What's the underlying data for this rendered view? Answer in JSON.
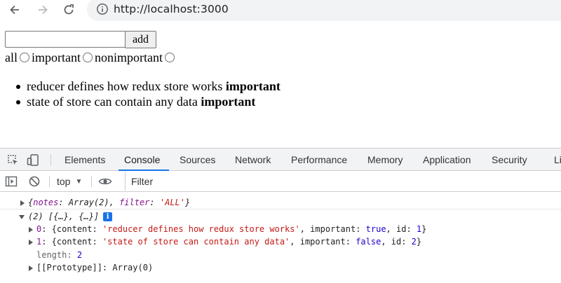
{
  "browser": {
    "url": "http://localhost:3000"
  },
  "page": {
    "add_label": "add",
    "note_input_value": "",
    "filters": [
      {
        "label": "all",
        "selected": false
      },
      {
        "label": "important",
        "selected": false
      },
      {
        "label": "nonimportant",
        "selected": false
      }
    ],
    "notes": [
      {
        "content": "reducer defines how redux store works",
        "tag": "important"
      },
      {
        "content": "state of store can contain any data",
        "tag": "important"
      }
    ]
  },
  "devtools": {
    "tabs": [
      "Elements",
      "Console",
      "Sources",
      "Network",
      "Performance",
      "Memory",
      "Application",
      "Security",
      "Li"
    ],
    "active_tab": "Console",
    "context": "top",
    "filter_placeholder": "Filter",
    "console": {
      "msg1": {
        "open": "{",
        "k1": "notes",
        "v1": "Array(2)",
        "k2": "filter",
        "v2": "'ALL'",
        "close": "}"
      },
      "msg2": {
        "summary": "(2) [{…}, {…}]",
        "info_badge": "i",
        "items": [
          {
            "index": "0",
            "content": "'reducer defines how redux store works'",
            "important": "true",
            "id": "1"
          },
          {
            "index": "1",
            "content": "'state of store can contain any data'",
            "important": "false",
            "id": "2"
          }
        ],
        "length_key": "length",
        "length_value": "2",
        "prototype_key": "[[Prototype]]",
        "prototype_value": "Array(0)"
      }
    }
  },
  "colors": {
    "accent": "#1a73e8",
    "string": "#c41a16",
    "key": "#881391",
    "number": "#1c00cf"
  }
}
